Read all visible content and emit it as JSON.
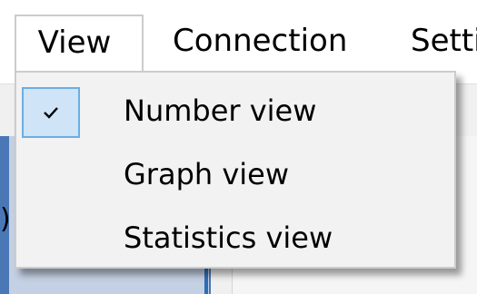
{
  "menubar": {
    "items": [
      {
        "label": "View"
      },
      {
        "label": "Connection"
      },
      {
        "label": "Setti"
      }
    ]
  },
  "view_menu": {
    "items": [
      {
        "label": "Number view",
        "checked": true
      },
      {
        "label": "Graph view",
        "checked": false
      },
      {
        "label": "Statistics view",
        "checked": false
      }
    ]
  },
  "background": {
    "partial_glyph": ")"
  },
  "colors": {
    "check_highlight": "#cfe4f7",
    "check_border": "#6aaee5",
    "menu_background": "#f2f2f2"
  }
}
